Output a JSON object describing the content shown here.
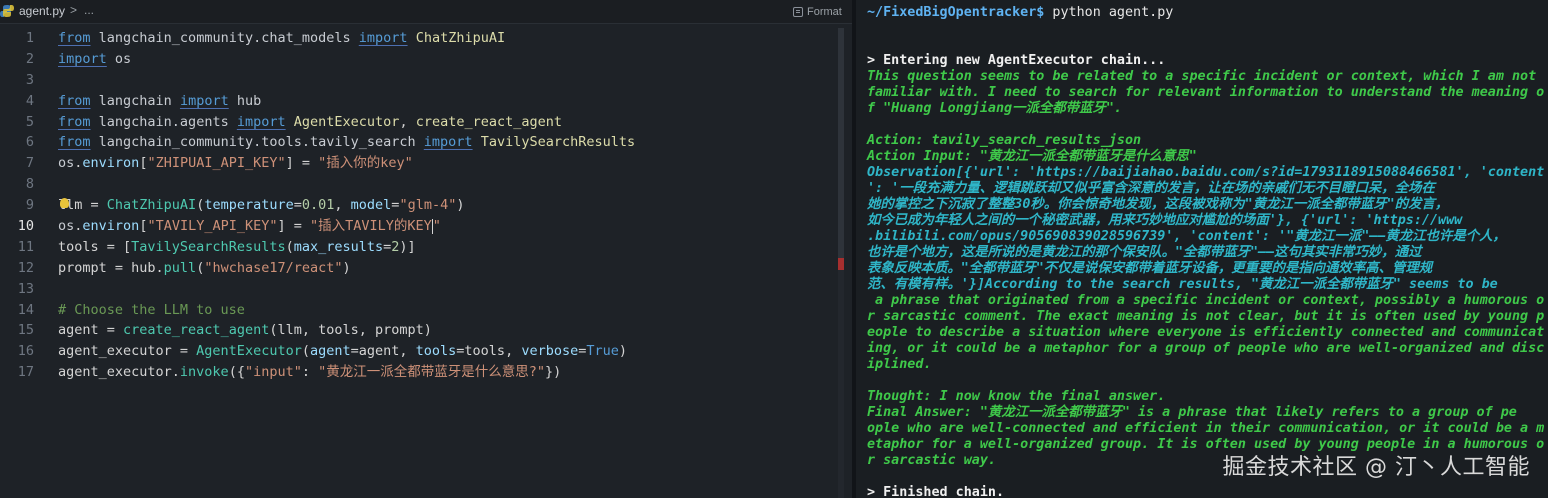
{
  "editor": {
    "tab": {
      "filename": "agent.py",
      "separator": ">",
      "more": "..."
    },
    "format_label": "Format",
    "active_line": 10,
    "lines": [
      {
        "n": "1",
        "html": [
          [
            "kw",
            "from"
          ],
          [
            "",
            " "
          ],
          [
            "mod",
            "langchain_community.chat_models"
          ],
          [
            "",
            " "
          ],
          [
            "kw",
            "import"
          ],
          [
            "",
            " "
          ],
          [
            "cls",
            "ChatZhipuAI"
          ]
        ]
      },
      {
        "n": "2",
        "html": [
          [
            "kw",
            "import"
          ],
          [
            "",
            " "
          ],
          [
            "mod",
            "os"
          ]
        ]
      },
      {
        "n": "3",
        "html": []
      },
      {
        "n": "4",
        "html": [
          [
            "kw",
            "from"
          ],
          [
            "",
            " "
          ],
          [
            "mod",
            "langchain"
          ],
          [
            "",
            " "
          ],
          [
            "kw",
            "import"
          ],
          [
            "",
            " "
          ],
          [
            "mod",
            "hub"
          ]
        ]
      },
      {
        "n": "5",
        "html": [
          [
            "kw",
            "from"
          ],
          [
            "",
            " "
          ],
          [
            "mod",
            "langchain.agents"
          ],
          [
            "",
            " "
          ],
          [
            "kw",
            "import"
          ],
          [
            "",
            " "
          ],
          [
            "cls",
            "AgentExecutor"
          ],
          [
            "",
            ", "
          ],
          [
            "cls",
            "create_react_agent"
          ]
        ]
      },
      {
        "n": "6",
        "html": [
          [
            "kw",
            "from"
          ],
          [
            "",
            " "
          ],
          [
            "mod",
            "langchain_community.tools.tavily_search"
          ],
          [
            "",
            " "
          ],
          [
            "kw",
            "import"
          ],
          [
            "",
            " "
          ],
          [
            "cls",
            "TavilySearchResults"
          ]
        ]
      },
      {
        "n": "7",
        "html": [
          [
            "mod",
            "os"
          ],
          [
            "",
            "."
          ],
          [
            "param",
            "environ"
          ],
          [
            "",
            "["
          ],
          [
            "str",
            "\"ZHIPUAI_API_KEY\""
          ],
          [
            "",
            "] = "
          ],
          [
            "str",
            "\"插入你的key\""
          ]
        ]
      },
      {
        "n": "8",
        "html": []
      },
      {
        "n": "9",
        "html": [
          [
            "",
            "llm = "
          ],
          [
            "fn",
            "ChatZhipuAI"
          ],
          [
            "",
            "("
          ],
          [
            "param",
            "temperature"
          ],
          [
            "",
            "="
          ],
          [
            "num",
            "0.01"
          ],
          [
            "",
            ", "
          ],
          [
            "param",
            "model"
          ],
          [
            "",
            "="
          ],
          [
            "str",
            "\"glm-4\""
          ],
          [
            "",
            ")"
          ]
        ]
      },
      {
        "n": "10",
        "html": [
          [
            "mod",
            "os"
          ],
          [
            "",
            "."
          ],
          [
            "param",
            "environ"
          ],
          [
            "",
            "["
          ],
          [
            "str",
            "\"TAVILY_API_KEY\""
          ],
          [
            "",
            "] = "
          ],
          [
            "str",
            "\"插入TAVILY的KEY"
          ],
          [
            "cursor",
            ""
          ],
          [
            "str",
            "\""
          ]
        ]
      },
      {
        "n": "11",
        "html": [
          [
            "",
            "tools = ["
          ],
          [
            "fn",
            "TavilySearchResults"
          ],
          [
            "",
            "("
          ],
          [
            "param",
            "max_results"
          ],
          [
            "",
            "="
          ],
          [
            "num",
            "2"
          ],
          [
            "",
            ")]"
          ]
        ]
      },
      {
        "n": "12",
        "html": [
          [
            "",
            "prompt = hub."
          ],
          [
            "fn",
            "pull"
          ],
          [
            "",
            "("
          ],
          [
            "str",
            "\"hwchase17/react\""
          ],
          [
            "",
            ")"
          ]
        ]
      },
      {
        "n": "13",
        "html": []
      },
      {
        "n": "14",
        "html": [
          [
            "cmt",
            "# Choose the LLM to use"
          ]
        ]
      },
      {
        "n": "15",
        "html": [
          [
            "",
            "agent = "
          ],
          [
            "fn",
            "create_react_agent"
          ],
          [
            "",
            "(llm, tools, prompt)"
          ]
        ]
      },
      {
        "n": "16",
        "html": [
          [
            "",
            "agent_executor = "
          ],
          [
            "fn",
            "AgentExecutor"
          ],
          [
            "",
            "("
          ],
          [
            "param",
            "agent"
          ],
          [
            "",
            "=agent, "
          ],
          [
            "param",
            "tools"
          ],
          [
            "",
            "=tools, "
          ],
          [
            "param",
            "verbose"
          ],
          [
            "",
            "="
          ],
          [
            "bool",
            "True"
          ],
          [
            "",
            ")"
          ]
        ]
      },
      {
        "n": "17",
        "html": [
          [
            "",
            "agent_executor."
          ],
          [
            "fn",
            "invoke"
          ],
          [
            "",
            "({"
          ],
          [
            "str",
            "\"input\""
          ],
          [
            "",
            ": "
          ],
          [
            "str",
            "\"黄龙江一派全都带蓝牙是什么意思?\""
          ],
          [
            "",
            "})"
          ]
        ]
      }
    ]
  },
  "terminal": {
    "prompt_path": "~/FixedBigOpentracker$",
    "prompt_cmd": " python agent.py",
    "lines": [
      {
        "cls": "t-white",
        "text": "> Entering new AgentExecutor chain..."
      },
      {
        "cls": "t-green",
        "text": "This question seems to be related to a specific incident or context, which I am not"
      },
      {
        "cls": "t-green",
        "text": "familiar with. I need to search for relevant information to understand the meaning o"
      },
      {
        "cls": "t-green",
        "text": "f \"Huang Longjiang一派全都带蓝牙\"."
      },
      {
        "cls": "",
        "text": ""
      },
      {
        "cls": "t-green",
        "text": "Action: tavily_search_results_json"
      },
      {
        "cls": "t-green",
        "text": "Action Input: \"黄龙江一派全都带蓝牙是什么意思\""
      },
      {
        "cls": "t-cyan",
        "text": "Observation[{'url': 'https://baijiahao.baidu.com/s?id=1793118915088466581', 'content"
      },
      {
        "cls": "t-cyan",
        "text": "': '一段充满力量、逻辑跳跃却又似乎富含深意的发言，让在场的亲戚们无不目瞪口呆，全场在"
      },
      {
        "cls": "t-cyan",
        "text": "她的掌控之下沉寂了整整30秒。你会惊奇地发现，这段被戏称为\"黄龙江一派全都带蓝牙\"的发言，"
      },
      {
        "cls": "t-cyan",
        "text": "如今已成为年轻人之间的一个秘密武器，用来巧妙地应对尴尬的场面'}, {'url': 'https://www"
      },
      {
        "cls": "t-cyan",
        "text": ".bilibili.com/opus/905690839028596739', 'content': '\"黄龙江一派\"——黄龙江也许是个人，"
      },
      {
        "cls": "t-cyan",
        "text": "也许是个地方，这是所说的是黄龙江的那个保安队。\"全都带蓝牙\"——这句其实非常巧妙，通过"
      },
      {
        "cls": "t-cyan",
        "text": "表象反映本质。\"全都带蓝牙\"不仅是说保安都带着蓝牙设备，更重要的是指向通效率高、管理规"
      },
      {
        "cls": "t-cyan",
        "text": "范、有模有样。'}]According to the search results, \"黄龙江一派全都带蓝牙\" seems to be"
      },
      {
        "cls": "t-green",
        "text": " a phrase that originated from a specific incident or context, possibly a humorous o"
      },
      {
        "cls": "t-green",
        "text": "r sarcastic comment. The exact meaning is not clear, but it is often used by young p"
      },
      {
        "cls": "t-green",
        "text": "eople to describe a situation where everyone is efficiently connected and communicat"
      },
      {
        "cls": "t-green",
        "text": "ing, or it could be a metaphor for a group of people who are well-organized and disc"
      },
      {
        "cls": "t-green",
        "text": "iplined."
      },
      {
        "cls": "",
        "text": ""
      },
      {
        "cls": "t-green",
        "text": "Thought: I now know the final answer."
      },
      {
        "cls": "t-green",
        "text": "Final Answer: \"黄龙江一派全都带蓝牙\" is a phrase that likely refers to a group of pe"
      },
      {
        "cls": "t-green",
        "text": "ople who are well-connected and efficient in their communication, or it could be a m"
      },
      {
        "cls": "t-green",
        "text": "etaphor for a well-organized group. It is often used by young people in a humorous o"
      },
      {
        "cls": "t-green",
        "text": "r sarcastic way."
      },
      {
        "cls": "",
        "text": ""
      },
      {
        "cls": "t-white",
        "text": "> Finished chain."
      }
    ]
  },
  "watermark": "掘金技术社区 @ 汀丶人工智能"
}
